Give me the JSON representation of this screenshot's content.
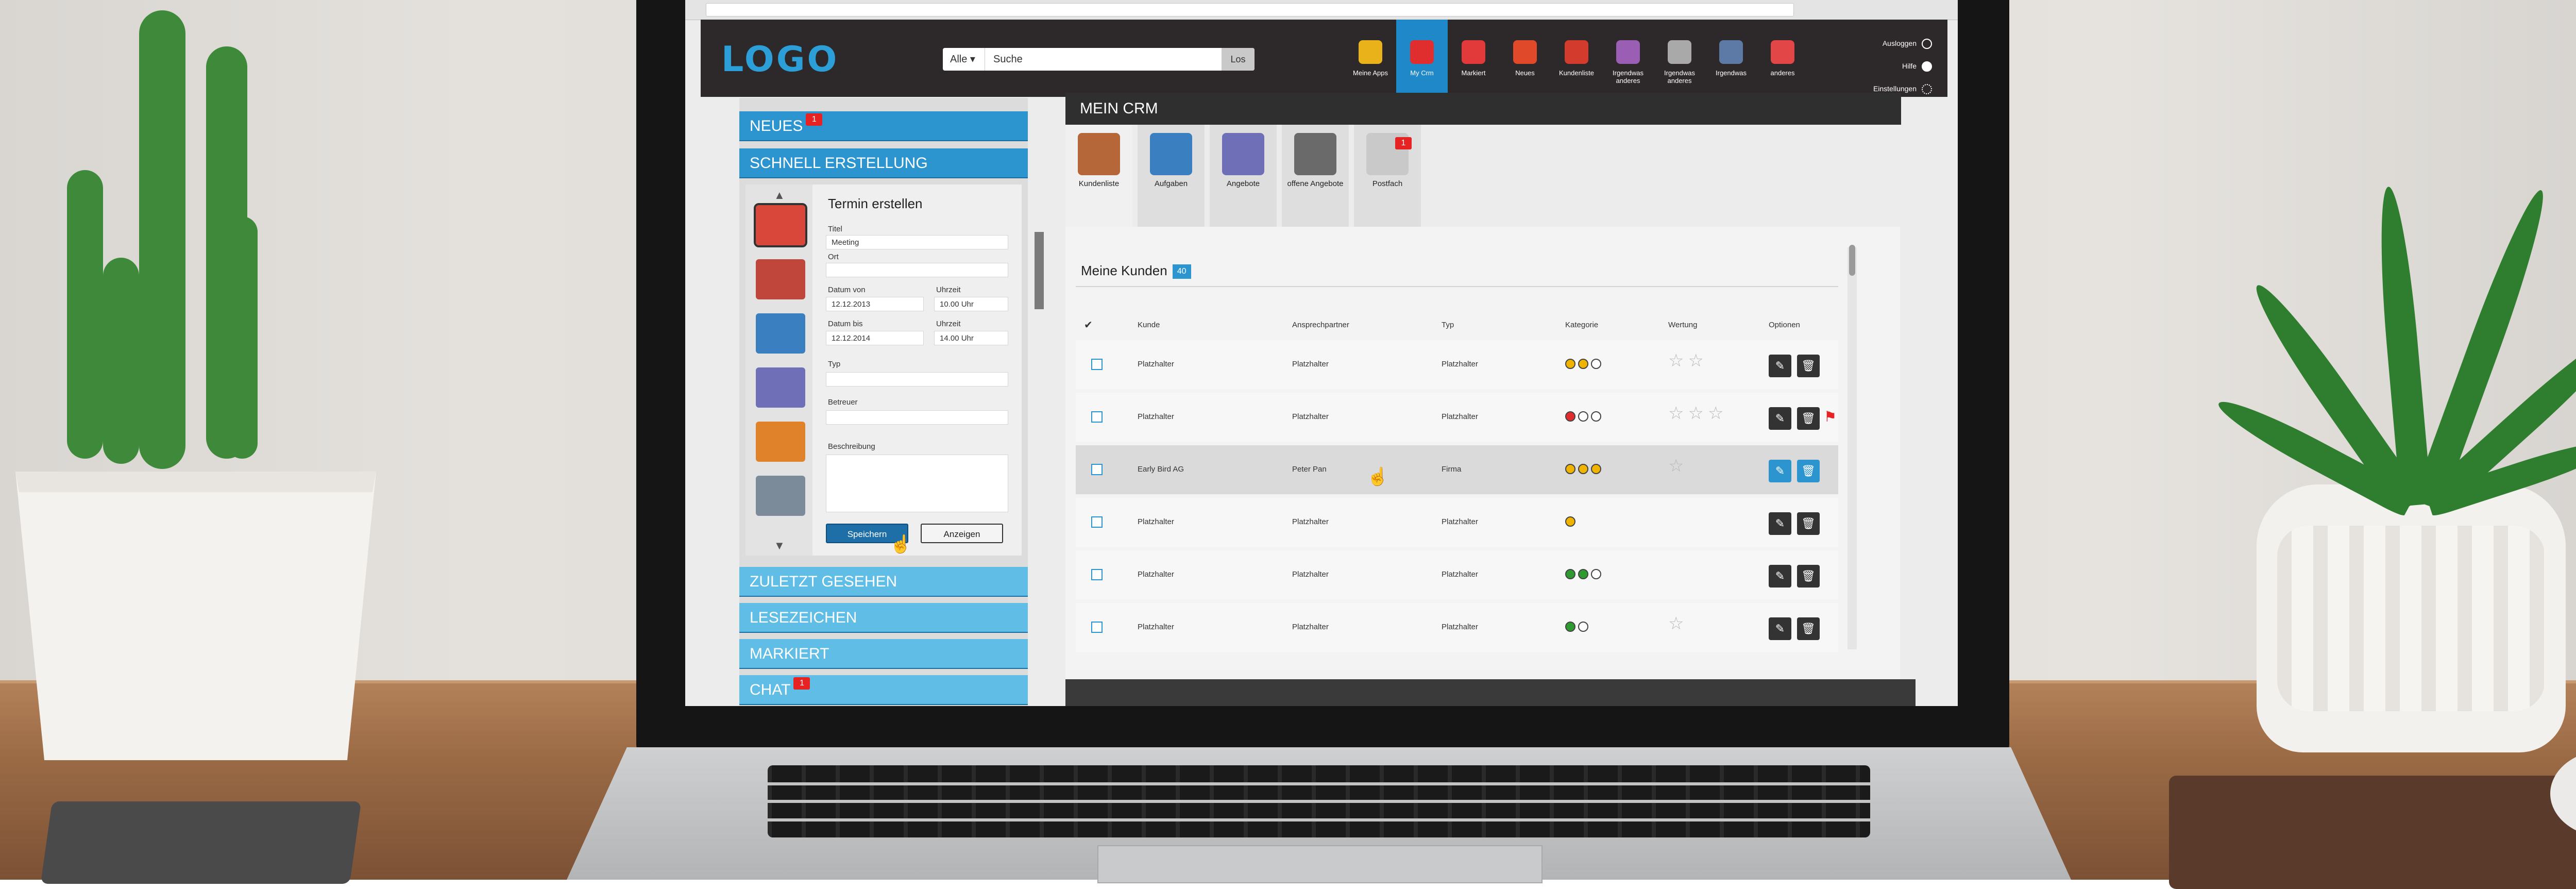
{
  "header": {
    "logo": "LOGO",
    "search": {
      "scope": "Alle",
      "scope_arrow": "▾",
      "value": "Suche",
      "button": "Los"
    },
    "nav": [
      {
        "label": "Meine Apps",
        "icon": "apps-icon",
        "color": "#e9b21b"
      },
      {
        "label": "My Crm",
        "icon": "heart-icon",
        "color": "#e02d2d",
        "active": true
      },
      {
        "label": "Markiert",
        "icon": "flag-icon",
        "color": "#e23a3a"
      },
      {
        "label": "Neues",
        "icon": "globe-icon",
        "color": "#e04a2a"
      },
      {
        "label": "Kundenliste",
        "icon": "person-icon",
        "color": "#d33c2c"
      },
      {
        "label": "Irgendwas anderes",
        "icon": "drop-icon",
        "color": "#9a5fb5"
      },
      {
        "label": "Irgendwas anderes",
        "icon": "phone-icon",
        "color": "#a9a9a9"
      },
      {
        "label": "Irgendwas",
        "icon": "book-icon",
        "color": "#5c7aa5"
      },
      {
        "label": "anderes",
        "icon": "lifebuoy-icon",
        "color": "#e24646"
      }
    ],
    "user": {
      "logout": "Ausloggen",
      "help": "Hilfe",
      "settings": "Einstellungen"
    }
  },
  "sidebar": {
    "neues": {
      "label": "NEUES",
      "badge": "1"
    },
    "schnell": {
      "label": "SCHNELL ERSTELLUNG"
    },
    "zuletzt": {
      "label": "ZULETZT GESEHEN"
    },
    "lesezeichen": {
      "label": "LESEZEICHEN"
    },
    "markiert": {
      "label": "MARKIERT"
    },
    "chat": {
      "label": "CHAT",
      "badge": "1"
    },
    "strip_up": "▲",
    "strip_down": "▼",
    "strip_icons": [
      {
        "icon": "mail-icon",
        "color": "#d9473a"
      },
      {
        "icon": "wallet-icon",
        "color": "#c0463b"
      },
      {
        "icon": "compass-icon",
        "color": "#3a7fbf"
      },
      {
        "icon": "chart-icon",
        "color": "#6e6fb6"
      },
      {
        "icon": "briefcase-icon",
        "color": "#e0822a"
      },
      {
        "icon": "monitor-icon",
        "color": "#7b8b99"
      }
    ]
  },
  "quickform": {
    "title": "Termin erstellen",
    "titel_label": "Titel",
    "titel_value": "Meeting",
    "ort_label": "Ort",
    "datum_von_label": "Datum von",
    "datum_von_value": "12.12.2013",
    "uhrzeit1_label": "Uhrzeit",
    "uhrzeit1_value": "10.00 Uhr",
    "datum_bis_label": "Datum bis",
    "datum_bis_value": "12.12.2014",
    "uhrzeit2_label": "Uhrzeit",
    "uhrzeit2_value": "14.00 Uhr",
    "typ_label": "Typ",
    "betreuer_label": "Betreuer",
    "beschreibung_label": "Beschreibung",
    "save": "Speichern",
    "show": "Anzeigen"
  },
  "crm": {
    "title": "MEIN CRM",
    "tabs": [
      {
        "label": "Kundenliste",
        "icon": "clipboard-icon",
        "color": "#b5673a",
        "active": true
      },
      {
        "label": "Aufgaben",
        "icon": "compass-icon",
        "color": "#3a7fbf"
      },
      {
        "label": "Angebote",
        "icon": "chart-icon",
        "color": "#6e6fb6"
      },
      {
        "label": "offene Angebote",
        "icon": "printer-icon",
        "color": "#6a6a6a"
      },
      {
        "label": "Postfach",
        "icon": "envelope-icon",
        "color": "#c9c9c9",
        "badge": "1"
      }
    ],
    "section_title": "Meine Kunden",
    "section_count": "40",
    "columns": {
      "check": "✔",
      "kunde": "Kunde",
      "ansprechpartner": "Ansprechpartner",
      "typ": "Typ",
      "kategorie": "Kategorie",
      "wertung": "Wertung",
      "optionen": "Optionen"
    },
    "rows": [
      {
        "kunde": "Platzhalter",
        "ansprechpartner": "Platzhalter",
        "typ": "Platzhalter",
        "kategorie": [
          "#f0b400",
          "#f0b400",
          "#ffffff"
        ],
        "wertung_stars": 2,
        "flag": false,
        "highlight": false
      },
      {
        "kunde": "Platzhalter",
        "ansprechpartner": "Platzhalter",
        "typ": "Platzhalter",
        "kategorie": [
          "#e02d2d",
          "#ffffff",
          "#ffffff"
        ],
        "wertung_stars": 3,
        "flag": true,
        "highlight": false
      },
      {
        "kunde": "Early Bird AG",
        "ansprechpartner": "Peter Pan",
        "typ": "Firma",
        "kategorie": [
          "#f0b400",
          "#f0b400",
          "#f0b400"
        ],
        "wertung_stars": 1,
        "flag": false,
        "highlight": true
      },
      {
        "kunde": "Platzhalter",
        "ansprechpartner": "Platzhalter",
        "typ": "Platzhalter",
        "kategorie": [
          "#f0b400"
        ],
        "wertung_stars": 0,
        "flag": false,
        "highlight": false
      },
      {
        "kunde": "Platzhalter",
        "ansprechpartner": "Platzhalter",
        "typ": "Platzhalter",
        "kategorie": [
          "#2f9a2f",
          "#2f9a2f",
          "#ffffff"
        ],
        "wertung_stars": 0,
        "flag": false,
        "highlight": false
      },
      {
        "kunde": "Platzhalter",
        "ansprechpartner": "Platzhalter",
        "typ": "Platzhalter",
        "kategorie": [
          "#2f9a2f",
          "#ffffff"
        ],
        "wertung_stars": 1,
        "flag": false,
        "highlight": false
      }
    ]
  }
}
